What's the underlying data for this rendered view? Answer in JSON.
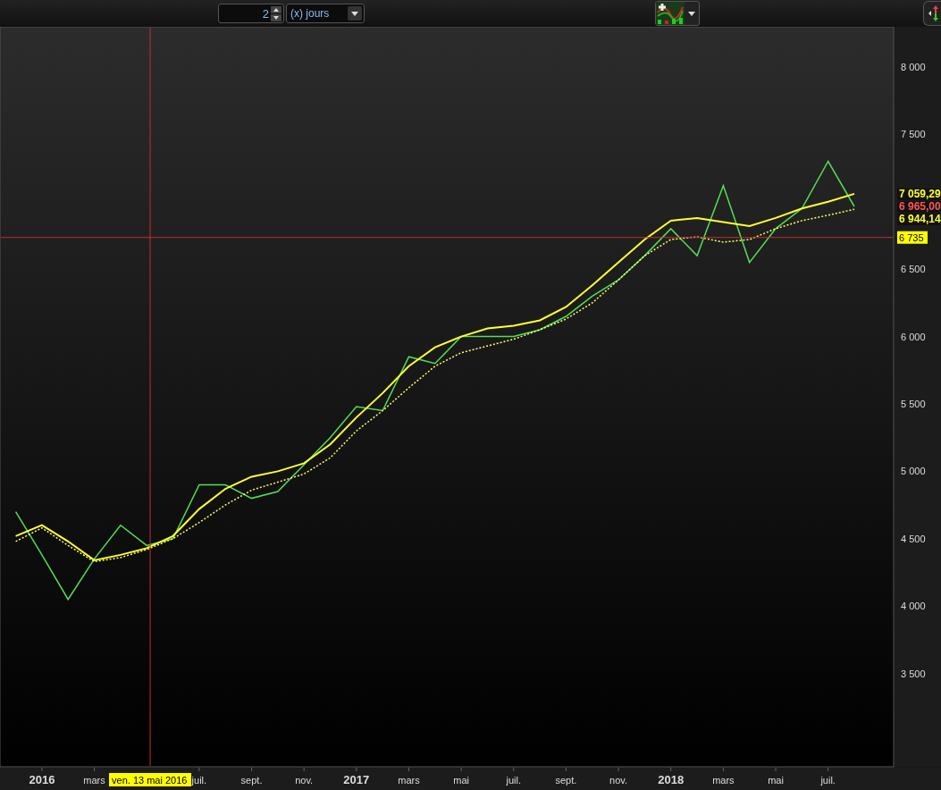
{
  "toolbar": {
    "period": {
      "value": "2"
    },
    "unit": {
      "value": "(x) jours"
    }
  },
  "chart": {
    "last_values": [
      {
        "text": "7 059,29",
        "color": "#ffff33"
      },
      {
        "text": "6 965,00",
        "color": "#ff5555"
      },
      {
        "text": "6 944,14",
        "color": "#ffff33"
      }
    ],
    "chart_data": {
      "type": "line",
      "ylim": [
        2808,
        8298
      ],
      "categories": [
        null,
        "2016",
        null,
        "mars",
        null,
        "ven. 13 mai 2016",
        null,
        "juil.",
        null,
        "sept.",
        null,
        "nov.",
        null,
        "2017",
        null,
        "mars",
        null,
        "mai",
        null,
        "juil.",
        null,
        "sept.",
        null,
        "nov.",
        null,
        "2018",
        null,
        "mars",
        null,
        "mai",
        null,
        "juil.",
        null
      ],
      "series": [
        {
          "color": "#55dd55",
          "values": [
            4700,
            4380,
            4050,
            4350,
            4600,
            4450,
            4500,
            4900,
            4900,
            4800,
            4850,
            5050,
            5250,
            5480,
            5450,
            5850,
            5800,
            6000,
            6000,
            6000,
            6050,
            6150,
            6300,
            6420,
            6600,
            6800,
            6600,
            7120,
            6550,
            6800,
            6950,
            7300,
            6965
          ]
        },
        {
          "color": "#ffff33",
          "line_style": "solid",
          "values": [
            4520,
            4600,
            4480,
            4340,
            4380,
            4430,
            4520,
            4720,
            4870,
            4960,
            5000,
            5060,
            5200,
            5400,
            5580,
            5780,
            5920,
            6000,
            6060,
            6080,
            6120,
            6220,
            6380,
            6550,
            6720,
            6860,
            6880,
            6850,
            6820,
            6880,
            6950,
            7000,
            7059
          ]
        },
        {
          "color": "#ffff66",
          "line_style": "dotted",
          "values": [
            4480,
            4580,
            4450,
            4330,
            4360,
            4420,
            4500,
            4620,
            4750,
            4860,
            4920,
            4980,
            5100,
            5300,
            5450,
            5620,
            5780,
            5880,
            5930,
            5980,
            6050,
            6130,
            6250,
            6420,
            6600,
            6720,
            6740,
            6700,
            6720,
            6800,
            6860,
            6900,
            6944
          ]
        }
      ],
      "yticks": [
        {
          "value": 3500,
          "label": "3 500"
        },
        {
          "value": 4000,
          "label": "4 000"
        },
        {
          "value": 4500,
          "label": "4 500"
        },
        {
          "value": 5000,
          "label": "5 000"
        },
        {
          "value": 5500,
          "label": "5 500"
        },
        {
          "value": 6000,
          "label": "6 000"
        },
        {
          "value": 6500,
          "label": "6 500"
        },
        {
          "value": 7500,
          "label": "7 500"
        },
        {
          "value": 8000,
          "label": "8 000"
        }
      ],
      "ref_lines": [
        {
          "axis": "x",
          "value": "ven. 13 mai 2016"
        },
        {
          "axis": "y",
          "value": 6735,
          "label": "6 735"
        }
      ]
    }
  }
}
